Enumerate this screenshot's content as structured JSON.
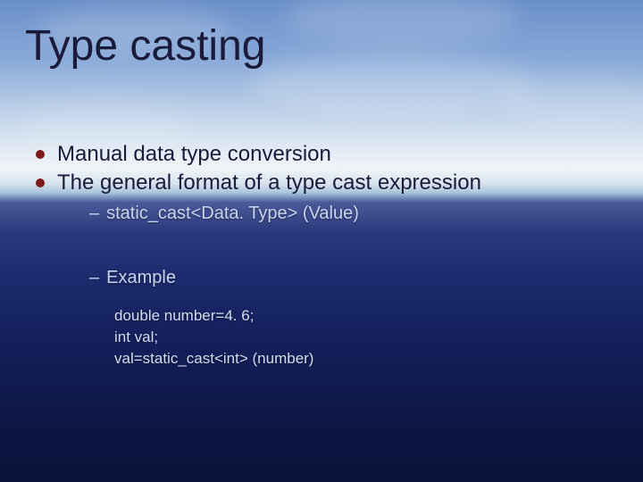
{
  "title": "Type casting",
  "bullets": [
    {
      "text": "Manual data type conversion"
    },
    {
      "text": "The general format of a type cast expression"
    }
  ],
  "sub": {
    "syntax": "static_cast<Data. Type> (Value)",
    "example_label": "Example"
  },
  "code": {
    "l1": "double number=4. 6;",
    "l2": "int val;",
    "l3": "val=static_cast<int> (number)"
  }
}
